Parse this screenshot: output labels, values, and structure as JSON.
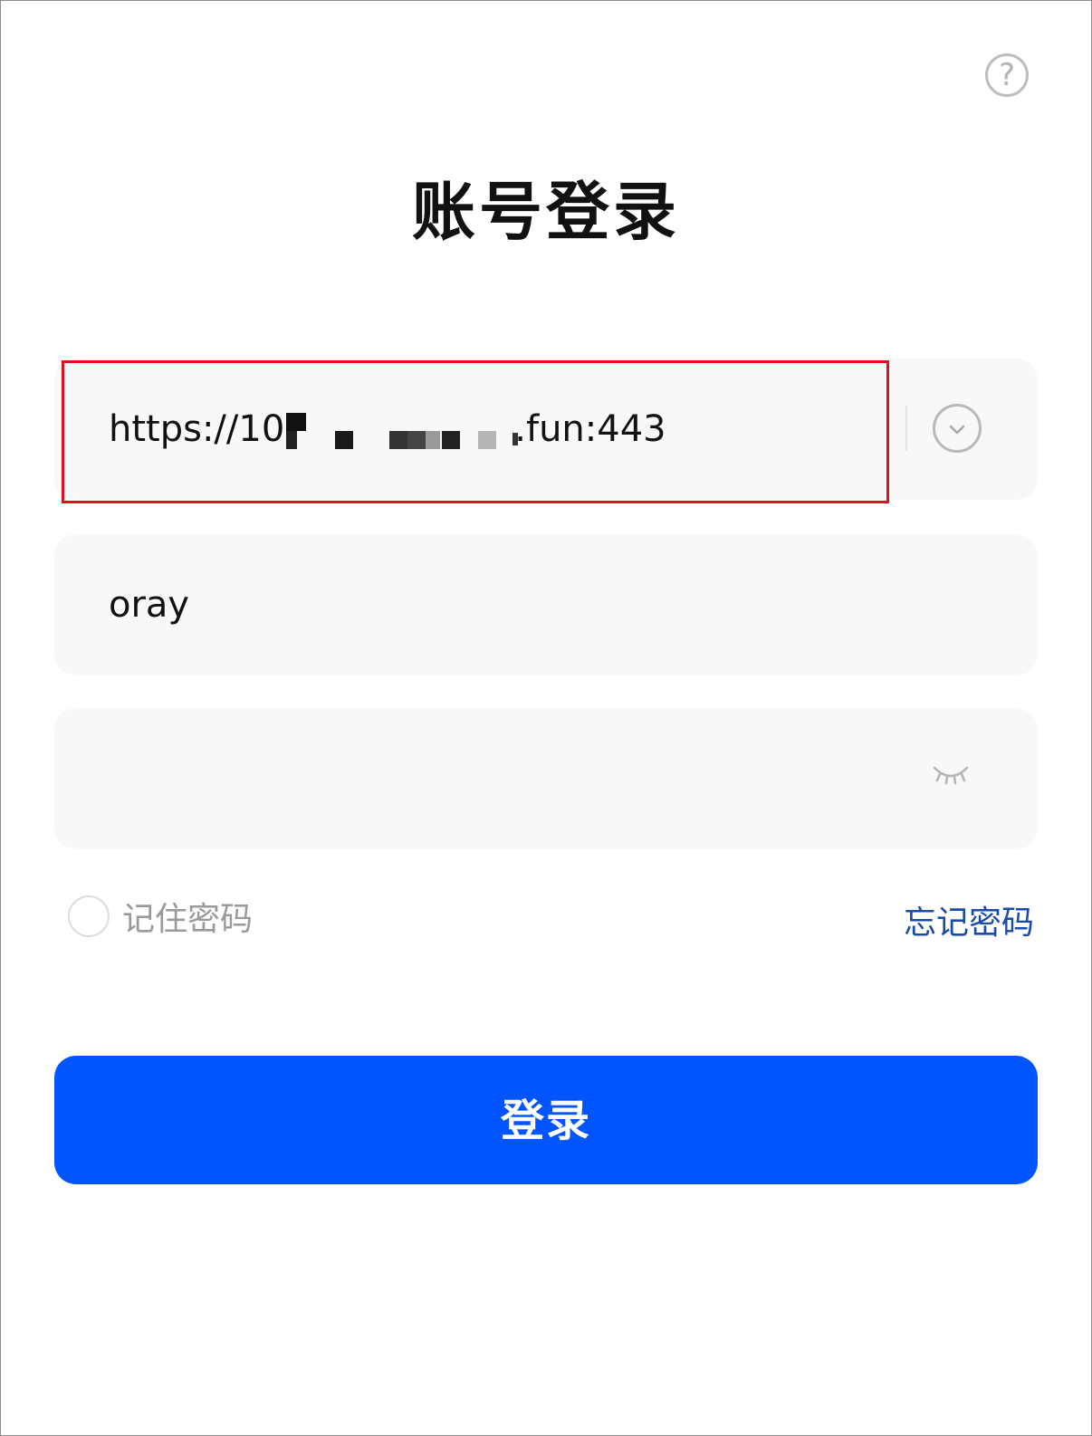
{
  "header": {
    "help_icon": "question-circle-icon",
    "help_glyph": "?"
  },
  "title": "账号登录",
  "form": {
    "server": {
      "prefix": "https://10",
      "suffix": ".fun:443",
      "dropdown_icon": "chevron-down-circle-icon"
    },
    "username": {
      "value": "oray"
    },
    "password": {
      "value": "",
      "toggle_icon": "eye-closed-icon"
    },
    "remember_label": "记住密码",
    "remember_checked": false,
    "forgot_label": "忘记密码",
    "submit_label": "登录"
  },
  "colors": {
    "primary": "#0055ff",
    "link": "#1a4ba8",
    "highlight": "#e0101e",
    "field_bg": "#f8f8f8"
  }
}
